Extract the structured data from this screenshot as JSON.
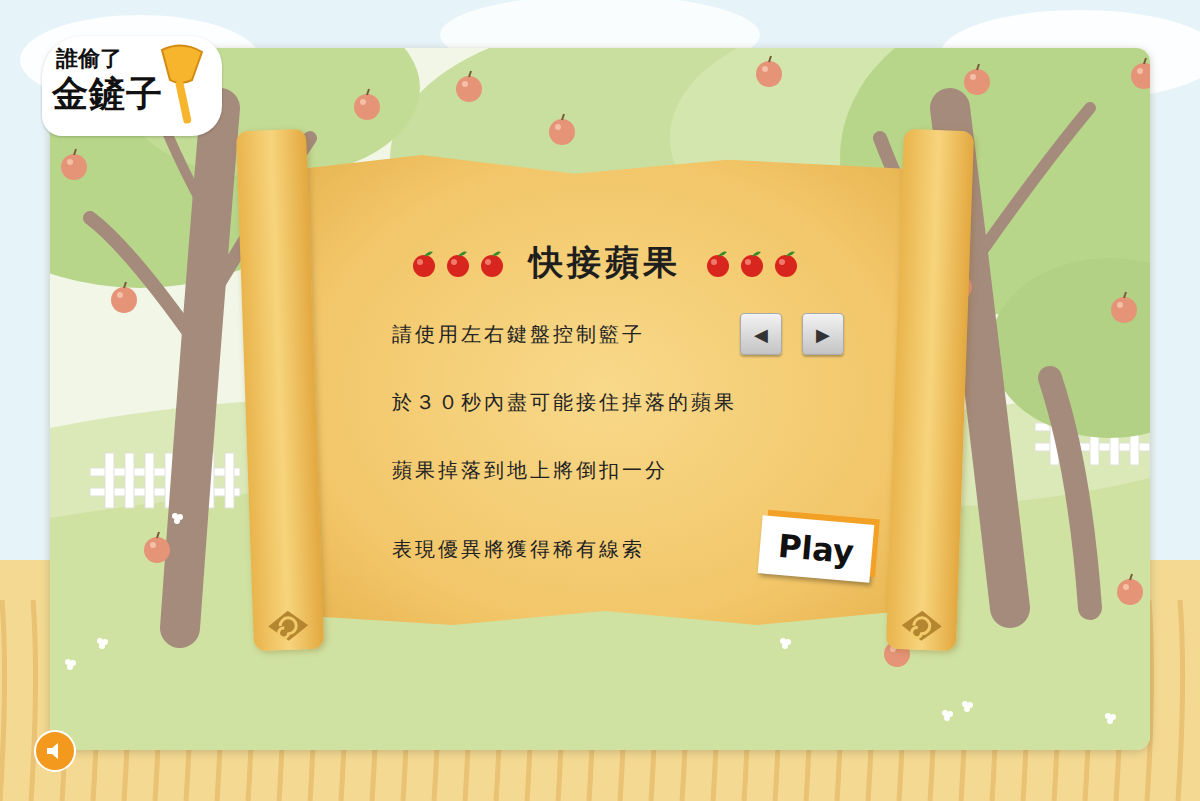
{
  "logo": {
    "line1": "誰偷了",
    "line2": "金鏟子"
  },
  "title": "快接蘋果",
  "instructions": [
    {
      "kind": "keys",
      "text": "請使用左右鍵盤控制籃子",
      "keys": [
        "◀",
        "▶"
      ]
    },
    {
      "kind": "text",
      "text": "於３０秒內盡可能接住掉落的蘋果",
      "keys": []
    },
    {
      "kind": "text",
      "text": "蘋果掉落到地上將倒扣一分",
      "keys": []
    },
    {
      "kind": "button",
      "text": "表現優異將獲得稀有線索",
      "keys": []
    }
  ],
  "play_button": "Play"
}
